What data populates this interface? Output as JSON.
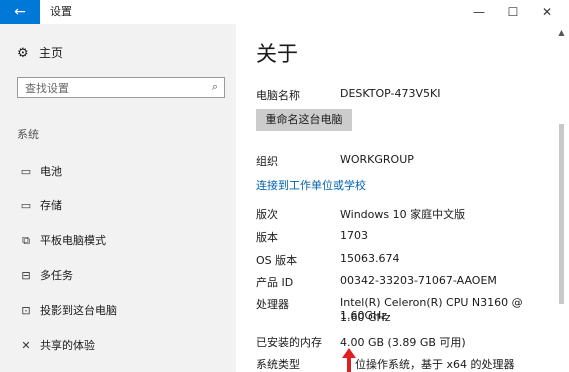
{
  "window": {
    "title": "设置",
    "back_glyph": "←",
    "minimize": "—",
    "maximize": "☐",
    "close": "✕"
  },
  "sidebar": {
    "home": "主页",
    "search_placeholder": "查找设置",
    "section": "系统",
    "items": [
      {
        "label": "电池",
        "icon": "battery-icon"
      },
      {
        "label": "存储",
        "icon": "storage-icon"
      },
      {
        "label": "平板电脑模式",
        "icon": "tablet-mode-icon"
      },
      {
        "label": "多任务",
        "icon": "multitasking-icon"
      },
      {
        "label": "投影到这台电脑",
        "icon": "projecting-icon"
      },
      {
        "label": "共享的体验",
        "icon": "shared-experiences-icon"
      }
    ]
  },
  "about": {
    "title": "关于",
    "device_name_label": "电脑名称",
    "device_name": "DESKTOP-473V5KI",
    "rename_button": "重命名这台电脑",
    "workgroup_label": "组织",
    "workgroup": "WORKGROUP",
    "connect_link": "连接到工作单位或学校",
    "edition_label": "版次",
    "edition": "Windows 10 家庭中文版",
    "version_label": "版本",
    "version": "1703",
    "os_build_label": "OS 版本",
    "os_build": "15063.674",
    "product_id_label": "产品 ID",
    "product_id": "00342-33203-71067-AAOEM",
    "processor_label": "处理器",
    "processor_line1": "Intel(R) Celeron(R) CPU  N3160 @ 1.60GHz",
    "processor_line2": "1.60 GHz",
    "ram_label": "已安装的内存",
    "ram": "4.00 GB (3.89 GB 可用)",
    "system_type_label": "系统类型",
    "system_type": "位操作系统，基于 x64 的处理器"
  },
  "colors": {
    "accent": "#0078d7",
    "link": "#0063b1",
    "annotation_arrow": "#e02020"
  }
}
